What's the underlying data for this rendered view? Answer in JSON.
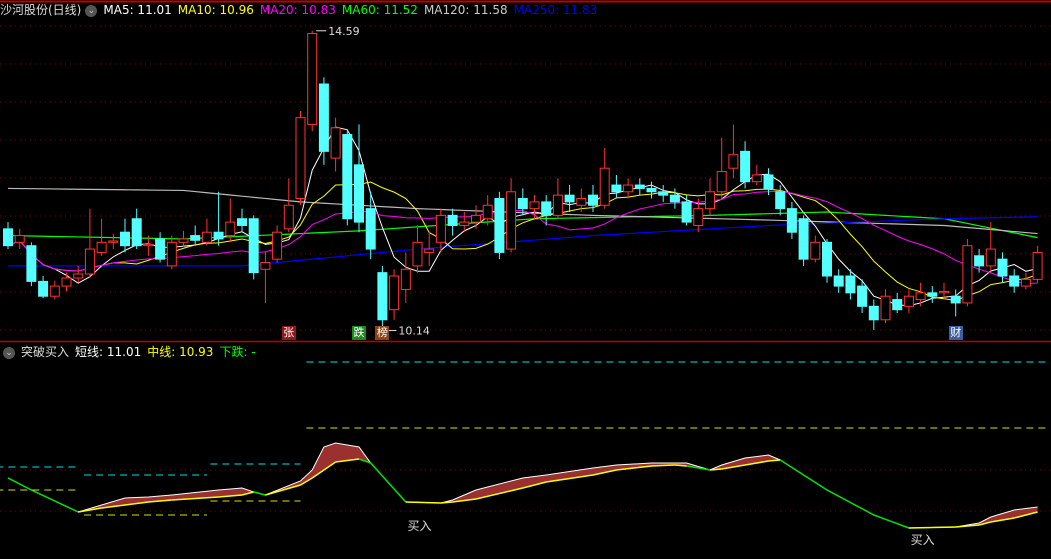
{
  "top_legend": {
    "title": "沙河股份(日线)",
    "items": [
      {
        "label": "MA5: 11.01",
        "color": "#ffffff"
      },
      {
        "label": "MA10: 10.96",
        "color": "#ffff00"
      },
      {
        "label": "MA20: 10.83",
        "color": "#ff00ff"
      },
      {
        "label": "MA60: 11.52",
        "color": "#00ff00"
      },
      {
        "label": "MA120: 11.58",
        "color": "#cccccc"
      },
      {
        "label": "MA250: 11.83",
        "color": "#0000ff"
      }
    ]
  },
  "bottom_legend": {
    "title": "突破买入",
    "items": [
      {
        "label": "短线: 11.01",
        "color": "#ffffff"
      },
      {
        "label": "中线: 10.93",
        "color": "#ffff00"
      },
      {
        "label": "下跌: -",
        "color": "#00ff00"
      }
    ]
  },
  "markers": [
    {
      "text": "张",
      "bg": "#8b1a1a",
      "candle": 24
    },
    {
      "text": "跌",
      "bg": "#1a8b1a",
      "candle": 30
    },
    {
      "text": "榜",
      "bg": "#8b4513",
      "candle": 32
    },
    {
      "text": "财",
      "bg": "#3a5fa0",
      "candle": 81
    }
  ],
  "buy_labels": [
    {
      "text": "买入",
      "candle": 35,
      "value": 20
    },
    {
      "text": "买入",
      "candle": 78,
      "value": 6
    }
  ],
  "colors": {
    "up": "#ff3232",
    "down": "#54ffff",
    "grid": "#7a0000",
    "fill": "#9a3030",
    "separator": "#c00000"
  },
  "chart_data": [
    {
      "type": "candlestick",
      "title": "沙河股份(日线)",
      "ylim": [
        10.0,
        14.75
      ],
      "high_label": {
        "text": "14.59",
        "candle": 26,
        "value": 14.59
      },
      "low_label": {
        "text": "10.14",
        "candle": 32,
        "value": 10.14
      },
      "ohlc_fields": [
        "open",
        "close",
        "high",
        "low"
      ],
      "candles": [
        [
          11.65,
          11.4,
          11.75,
          11.35
        ],
        [
          11.45,
          11.55,
          11.65,
          11.35
        ],
        [
          11.4,
          10.87,
          11.45,
          10.8
        ],
        [
          10.87,
          10.65,
          10.95,
          10.62
        ],
        [
          10.65,
          10.8,
          10.88,
          10.6
        ],
        [
          10.8,
          10.92,
          11.0,
          10.72
        ],
        [
          10.92,
          10.98,
          11.1,
          10.85
        ],
        [
          10.98,
          11.35,
          11.95,
          10.92
        ],
        [
          11.3,
          11.45,
          11.8,
          11.25
        ],
        [
          11.45,
          11.47,
          11.58,
          11.35
        ],
        [
          11.6,
          11.4,
          11.8,
          11.3
        ],
        [
          11.8,
          11.4,
          11.95,
          11.35
        ],
        [
          11.4,
          11.42,
          11.55,
          11.25
        ],
        [
          11.5,
          11.2,
          11.6,
          11.15
        ],
        [
          11.1,
          11.45,
          11.55,
          11.05
        ],
        [
          11.45,
          11.5,
          11.62,
          11.38
        ],
        [
          11.55,
          11.48,
          11.7,
          11.4
        ],
        [
          11.45,
          11.6,
          11.8,
          11.4
        ],
        [
          11.6,
          11.5,
          12.2,
          11.4
        ],
        [
          11.55,
          11.75,
          12.1,
          11.45
        ],
        [
          11.8,
          11.7,
          11.95,
          11.6
        ],
        [
          11.8,
          11.0,
          11.85,
          10.9
        ],
        [
          11.05,
          11.15,
          11.3,
          10.55
        ],
        [
          11.2,
          11.6,
          11.7,
          11.15
        ],
        [
          11.65,
          12.0,
          12.4,
          11.6
        ],
        [
          12.1,
          13.3,
          13.4,
          12.0
        ],
        [
          13.2,
          14.55,
          14.59,
          13.1
        ],
        [
          13.8,
          12.8,
          13.9,
          12.6
        ],
        [
          12.7,
          13.15,
          13.3,
          12.5
        ],
        [
          13.05,
          11.8,
          13.1,
          11.7
        ],
        [
          12.6,
          11.75,
          13.2,
          11.6
        ],
        [
          11.95,
          11.35,
          12.2,
          11.2
        ],
        [
          11.0,
          10.3,
          11.1,
          10.14
        ],
        [
          10.45,
          10.95,
          11.05,
          10.3
        ],
        [
          10.75,
          11.05,
          11.3,
          10.55
        ],
        [
          11.1,
          11.45,
          11.7,
          11.0
        ],
        [
          11.3,
          11.35,
          11.6,
          11.1
        ],
        [
          11.45,
          11.85,
          11.95,
          11.3
        ],
        [
          11.85,
          11.7,
          11.95,
          11.55
        ],
        [
          11.7,
          11.75,
          11.9,
          11.6
        ],
        [
          11.75,
          11.85,
          12.0,
          11.65
        ],
        [
          11.8,
          12.0,
          12.15,
          11.7
        ],
        [
          12.1,
          11.3,
          12.2,
          11.2
        ],
        [
          11.35,
          12.2,
          12.4,
          11.3
        ],
        [
          12.1,
          11.95,
          12.25,
          11.85
        ],
        [
          11.95,
          12.05,
          12.15,
          11.8
        ],
        [
          12.05,
          11.85,
          12.15,
          11.7
        ],
        [
          11.85,
          12.15,
          12.4,
          11.8
        ],
        [
          12.15,
          12.05,
          12.3,
          11.9
        ],
        [
          12.0,
          12.1,
          12.25,
          11.9
        ],
        [
          12.15,
          12.0,
          12.3,
          11.9
        ],
        [
          12.0,
          12.55,
          12.85,
          11.95
        ],
        [
          12.3,
          12.2,
          12.45,
          12.1
        ],
        [
          12.2,
          12.3,
          12.4,
          12.1
        ],
        [
          12.3,
          12.25,
          12.4,
          12.15
        ],
        [
          12.25,
          12.2,
          12.35,
          12.1
        ],
        [
          12.2,
          12.15,
          12.3,
          12.05
        ],
        [
          12.15,
          12.05,
          12.25,
          11.95
        ],
        [
          12.05,
          11.75,
          12.15,
          11.7
        ],
        [
          11.7,
          11.95,
          12.1,
          11.6
        ],
        [
          11.95,
          12.2,
          12.4,
          11.85
        ],
        [
          12.2,
          12.5,
          13.0,
          12.1
        ],
        [
          12.55,
          12.75,
          13.2,
          12.4
        ],
        [
          12.8,
          12.35,
          12.95,
          12.25
        ],
        [
          12.35,
          12.45,
          12.6,
          12.3
        ],
        [
          12.45,
          12.25,
          12.55,
          12.15
        ],
        [
          12.2,
          11.95,
          12.3,
          11.85
        ],
        [
          11.95,
          11.6,
          12.05,
          11.5
        ],
        [
          11.8,
          11.2,
          11.85,
          11.1
        ],
        [
          11.2,
          11.45,
          11.55,
          11.15
        ],
        [
          11.45,
          10.95,
          11.5,
          10.85
        ],
        [
          10.95,
          10.8,
          11.05,
          10.7
        ],
        [
          10.95,
          10.7,
          11.05,
          10.6
        ],
        [
          10.8,
          10.5,
          10.9,
          10.4
        ],
        [
          10.5,
          10.3,
          10.6,
          10.15
        ],
        [
          10.3,
          10.65,
          10.75,
          10.25
        ],
        [
          10.6,
          10.45,
          10.7,
          10.4
        ],
        [
          10.5,
          10.65,
          10.75,
          10.4
        ],
        [
          10.6,
          10.7,
          10.85,
          10.5
        ],
        [
          10.7,
          10.65,
          10.8,
          10.55
        ],
        [
          10.7,
          10.72,
          10.85,
          10.6
        ],
        [
          10.65,
          10.55,
          10.75,
          10.35
        ],
        [
          10.55,
          11.4,
          11.5,
          10.5
        ],
        [
          11.25,
          11.1,
          11.35,
          11.0
        ],
        [
          11.1,
          11.35,
          11.75,
          11.0
        ],
        [
          11.2,
          10.95,
          11.3,
          10.85
        ],
        [
          10.95,
          10.8,
          11.05,
          10.7
        ],
        [
          10.8,
          10.9,
          11.0,
          10.75
        ],
        [
          10.9,
          11.3,
          11.4,
          10.85
        ]
      ],
      "long_mas": [
        {
          "name": "MA60",
          "color": "#00ff00",
          "points": [
            [
              0,
              11.55
            ],
            [
              15,
              11.5
            ],
            [
              30,
              11.62
            ],
            [
              45,
              11.8
            ],
            [
              60,
              11.85
            ],
            [
              70,
              11.9
            ],
            [
              80,
              11.8
            ],
            [
              88,
              11.52
            ]
          ]
        },
        {
          "name": "MA120",
          "color": "#bbbbbb",
          "points": [
            [
              0,
              12.25
            ],
            [
              15,
              12.22
            ],
            [
              25,
              12.05
            ],
            [
              35,
              11.95
            ],
            [
              50,
              11.85
            ],
            [
              65,
              11.78
            ],
            [
              80,
              11.7
            ],
            [
              88,
              11.58
            ]
          ]
        },
        {
          "name": "MA250",
          "color": "#0000ff",
          "points": [
            [
              0,
              11.1
            ],
            [
              20,
              11.1
            ],
            [
              35,
              11.35
            ],
            [
              50,
              11.55
            ],
            [
              65,
              11.7
            ],
            [
              80,
              11.8
            ],
            [
              88,
              11.83
            ]
          ]
        }
      ]
    },
    {
      "type": "area",
      "title": "突破买入",
      "ylim": [
        0,
        200
      ],
      "series_fields": [
        "candle",
        "mid",
        "short"
      ],
      "points": [
        [
          0,
          67,
          67
        ],
        [
          2,
          55,
          55
        ],
        [
          6,
          33,
          33
        ],
        [
          8,
          37,
          40
        ],
        [
          10,
          40,
          47
        ],
        [
          12,
          43,
          48
        ],
        [
          14,
          45,
          50
        ],
        [
          18,
          48,
          55
        ],
        [
          20,
          50,
          57
        ],
        [
          21,
          53,
          53
        ],
        [
          22,
          50,
          50
        ],
        [
          25,
          60,
          64
        ],
        [
          26,
          67,
          75
        ],
        [
          27,
          75,
          98
        ],
        [
          28,
          83,
          102
        ],
        [
          30,
          86,
          98
        ],
        [
          31,
          82,
          82
        ],
        [
          34,
          43,
          43
        ],
        [
          37,
          42,
          42
        ],
        [
          38,
          43,
          45
        ],
        [
          40,
          46,
          55
        ],
        [
          44,
          57,
          67
        ],
        [
          46,
          63,
          70
        ],
        [
          50,
          70,
          77
        ],
        [
          52,
          75,
          80
        ],
        [
          55,
          79,
          82
        ],
        [
          57,
          80,
          82
        ],
        [
          58,
          79,
          82
        ],
        [
          60,
          75,
          75
        ],
        [
          61,
          76,
          80
        ],
        [
          63,
          80,
          87
        ],
        [
          65,
          84,
          90
        ],
        [
          66,
          85,
          85
        ],
        [
          70,
          55,
          55
        ],
        [
          74,
          30,
          30
        ],
        [
          77,
          17,
          17
        ],
        [
          81,
          18,
          18
        ],
        [
          83,
          20,
          22
        ],
        [
          84,
          23,
          28
        ],
        [
          86,
          27,
          35
        ],
        [
          88,
          33,
          38
        ]
      ],
      "levels": [
        {
          "value": 183,
          "from": 25.5,
          "to": 89,
          "color": "#00e0e0"
        },
        {
          "value": 117,
          "from": 25.5,
          "to": 89,
          "color": "#e0e000"
        },
        {
          "value": 78,
          "from": -1,
          "to": 6,
          "color": "#00e0e0"
        },
        {
          "value": 55,
          "from": -1,
          "to": 6,
          "color": "#e0e000"
        },
        {
          "value": 70,
          "from": 6.5,
          "to": 17,
          "color": "#00e0e0"
        },
        {
          "value": 30,
          "from": 6.5,
          "to": 17,
          "color": "#e0e000"
        },
        {
          "value": 81,
          "from": 17.3,
          "to": 25,
          "color": "#00e0e0"
        },
        {
          "value": 44,
          "from": 17.3,
          "to": 25,
          "color": "#e0e000"
        }
      ]
    }
  ]
}
